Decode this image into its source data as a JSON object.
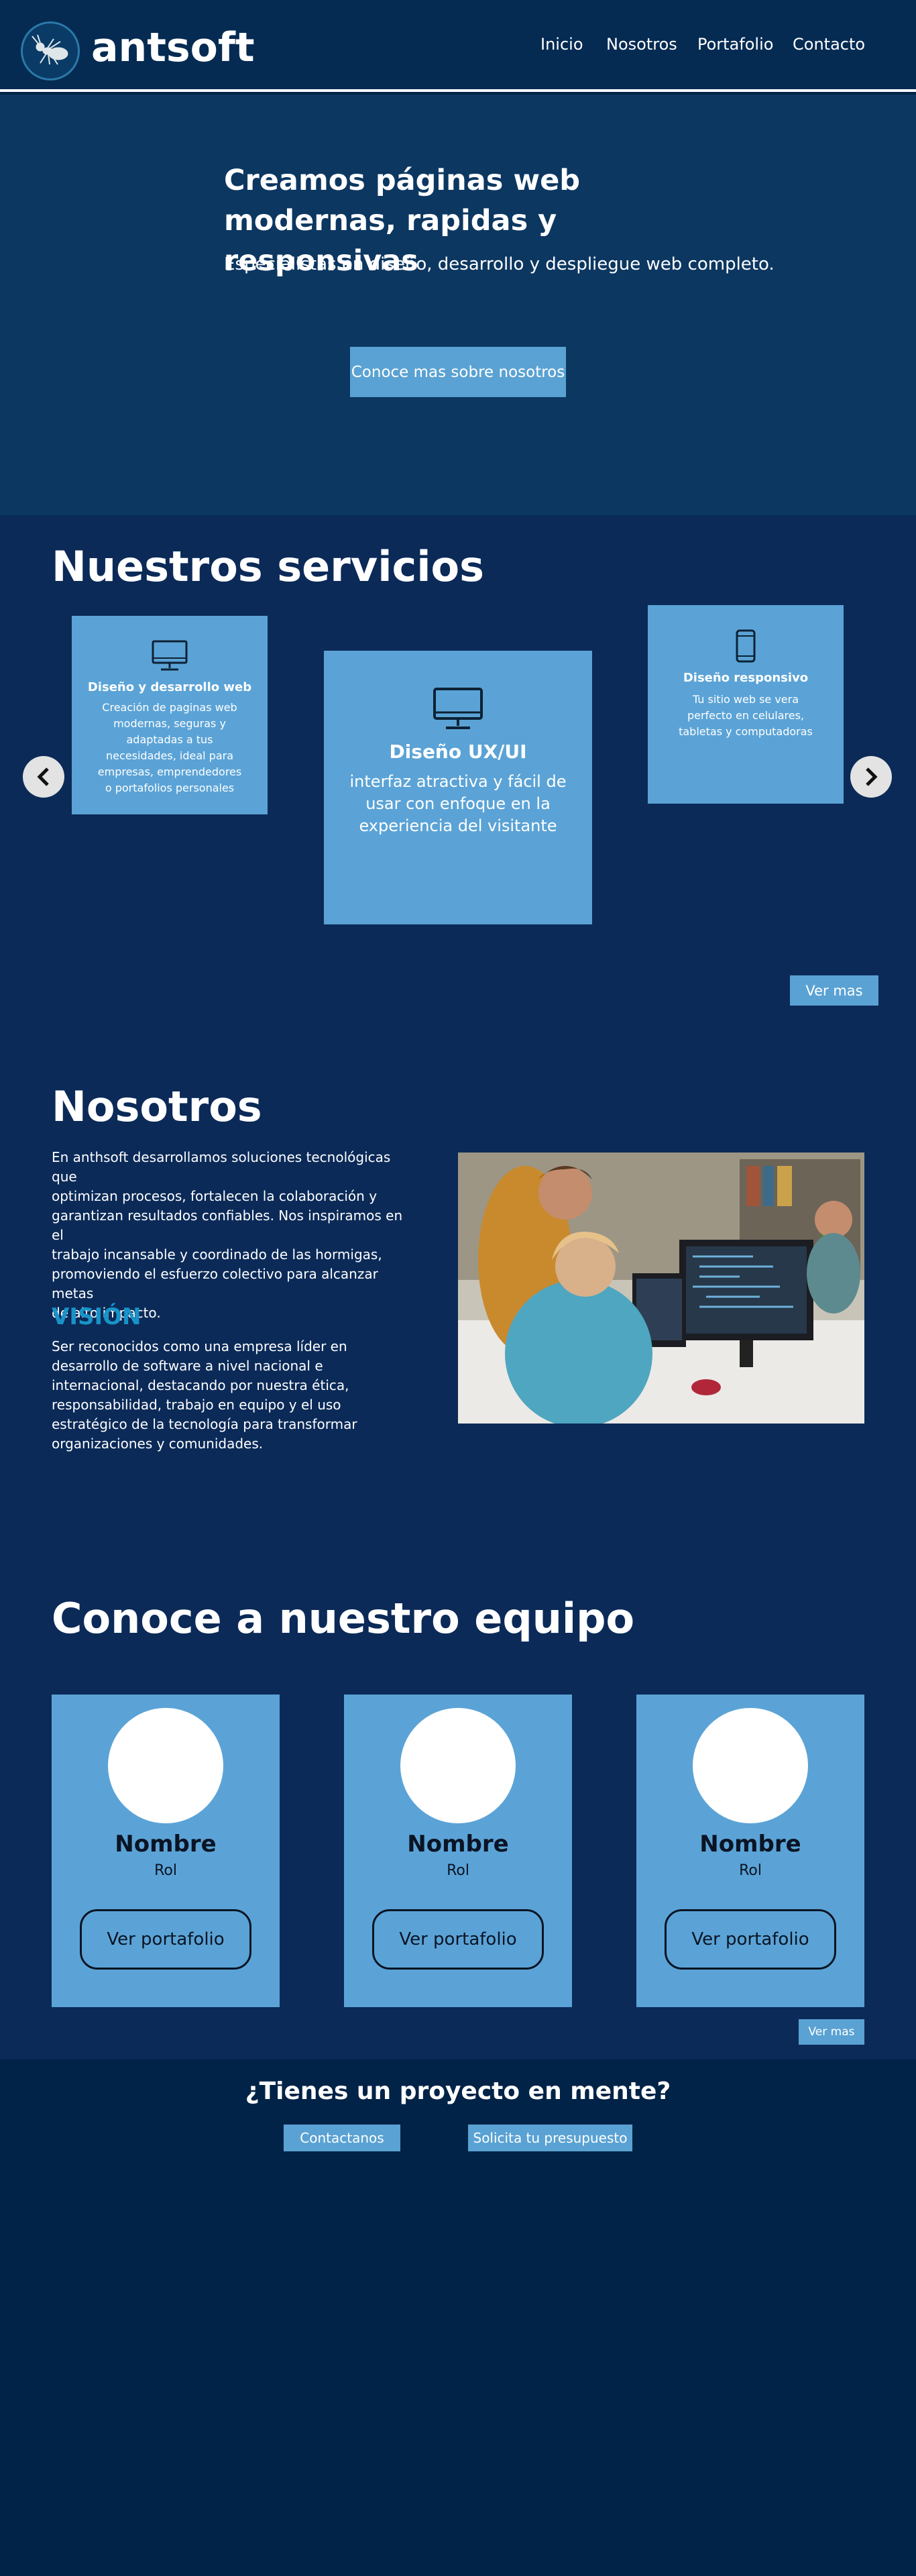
{
  "header": {
    "brand": "antsoft",
    "nav": [
      "Inicio",
      "Nosotros",
      "Portafolio",
      "Contacto"
    ]
  },
  "hero": {
    "title_line1": "Creamos páginas web",
    "title_line2": "modernas, rapidas y responsivas",
    "subtitle": "Especialistas en diseño, desarrollo y despliegue web completo.",
    "button": "Conoce mas sobre nosotros"
  },
  "services": {
    "title": "Nuestros servicios",
    "cards": [
      {
        "title": "Diseño y desarrollo web",
        "icon": "monitor-icon",
        "text_lines": [
          "Creación de paginas web",
          "modernas, seguras y",
          "adaptadas a tus",
          "necesidades, ideal para",
          "empresas, emprendedores",
          "o portafolios personales"
        ]
      },
      {
        "title": "Diseño UX/UI",
        "icon": "monitor-icon",
        "text_lines": [
          "interfaz atractiva y fácil de",
          "usar con enfoque en la",
          "experiencia del visitante"
        ]
      },
      {
        "title": "Diseño responsivo",
        "icon": "smartphone-icon",
        "text_lines": [
          "Tu sitio web se vera",
          "perfecto en celulares,",
          "tabletas y computadoras"
        ]
      }
    ],
    "ver_mas": "Ver mas"
  },
  "about": {
    "title": "Nosotros",
    "text_lines": [
      "En anthsoft desarrollamos soluciones tecnológicas que",
      "optimizan procesos, fortalecen la colaboración y",
      "garantizan resultados confiables. Nos inspiramos en el",
      "trabajo incansable y coordinado de las hormigas,",
      "promoviendo el esfuerzo colectivo para alcanzar metas",
      "de alto impacto."
    ],
    "vision_title": "VISIÓN",
    "vision_lines": [
      "Ser reconocidos como una empresa líder en",
      "desarrollo de software a nivel nacional e",
      "internacional, destacando por nuestra ética,",
      "responsabilidad, trabajo en equipo y el uso",
      "estratégico de la tecnología para transformar",
      "organizaciones y comunidades."
    ]
  },
  "team": {
    "title": "Conoce a nuestro equipo",
    "members": [
      {
        "name": "Nombre",
        "role": "Rol",
        "button": "Ver portafolio"
      },
      {
        "name": "Nombre",
        "role": "Rol",
        "button": "Ver portafolio"
      },
      {
        "name": "Nombre",
        "role": "Rol",
        "button": "Ver portafolio"
      }
    ],
    "ver_mas": "Ver mas"
  },
  "cta": {
    "title": "¿Tienes un proyecto en mente?",
    "contact_button": "Contactanos",
    "quote_button": "Solicita tu presupuesto"
  },
  "colors": {
    "header_bg": "#052b53",
    "hero_bg": "#0c3761",
    "section_bg": "#0b2a58",
    "accent": "#5aa2d3",
    "vision": "#1893c9",
    "footer_bg": "#022348"
  }
}
